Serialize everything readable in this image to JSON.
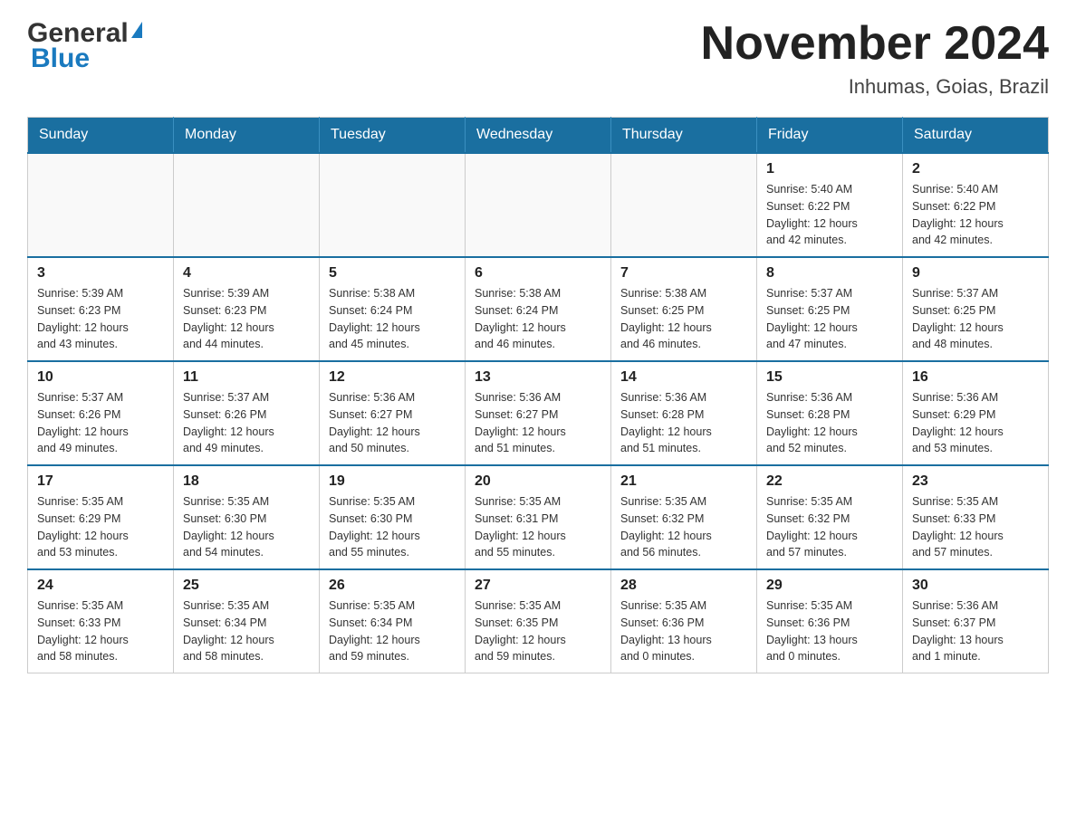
{
  "header": {
    "logo_text_black": "General",
    "logo_text_blue": "Blue",
    "month_title": "November 2024",
    "location": "Inhumas, Goias, Brazil"
  },
  "weekdays": [
    "Sunday",
    "Monday",
    "Tuesday",
    "Wednesday",
    "Thursday",
    "Friday",
    "Saturday"
  ],
  "weeks": [
    [
      {
        "day": "",
        "info": ""
      },
      {
        "day": "",
        "info": ""
      },
      {
        "day": "",
        "info": ""
      },
      {
        "day": "",
        "info": ""
      },
      {
        "day": "",
        "info": ""
      },
      {
        "day": "1",
        "info": "Sunrise: 5:40 AM\nSunset: 6:22 PM\nDaylight: 12 hours\nand 42 minutes."
      },
      {
        "day": "2",
        "info": "Sunrise: 5:40 AM\nSunset: 6:22 PM\nDaylight: 12 hours\nand 42 minutes."
      }
    ],
    [
      {
        "day": "3",
        "info": "Sunrise: 5:39 AM\nSunset: 6:23 PM\nDaylight: 12 hours\nand 43 minutes."
      },
      {
        "day": "4",
        "info": "Sunrise: 5:39 AM\nSunset: 6:23 PM\nDaylight: 12 hours\nand 44 minutes."
      },
      {
        "day": "5",
        "info": "Sunrise: 5:38 AM\nSunset: 6:24 PM\nDaylight: 12 hours\nand 45 minutes."
      },
      {
        "day": "6",
        "info": "Sunrise: 5:38 AM\nSunset: 6:24 PM\nDaylight: 12 hours\nand 46 minutes."
      },
      {
        "day": "7",
        "info": "Sunrise: 5:38 AM\nSunset: 6:25 PM\nDaylight: 12 hours\nand 46 minutes."
      },
      {
        "day": "8",
        "info": "Sunrise: 5:37 AM\nSunset: 6:25 PM\nDaylight: 12 hours\nand 47 minutes."
      },
      {
        "day": "9",
        "info": "Sunrise: 5:37 AM\nSunset: 6:25 PM\nDaylight: 12 hours\nand 48 minutes."
      }
    ],
    [
      {
        "day": "10",
        "info": "Sunrise: 5:37 AM\nSunset: 6:26 PM\nDaylight: 12 hours\nand 49 minutes."
      },
      {
        "day": "11",
        "info": "Sunrise: 5:37 AM\nSunset: 6:26 PM\nDaylight: 12 hours\nand 49 minutes."
      },
      {
        "day": "12",
        "info": "Sunrise: 5:36 AM\nSunset: 6:27 PM\nDaylight: 12 hours\nand 50 minutes."
      },
      {
        "day": "13",
        "info": "Sunrise: 5:36 AM\nSunset: 6:27 PM\nDaylight: 12 hours\nand 51 minutes."
      },
      {
        "day": "14",
        "info": "Sunrise: 5:36 AM\nSunset: 6:28 PM\nDaylight: 12 hours\nand 51 minutes."
      },
      {
        "day": "15",
        "info": "Sunrise: 5:36 AM\nSunset: 6:28 PM\nDaylight: 12 hours\nand 52 minutes."
      },
      {
        "day": "16",
        "info": "Sunrise: 5:36 AM\nSunset: 6:29 PM\nDaylight: 12 hours\nand 53 minutes."
      }
    ],
    [
      {
        "day": "17",
        "info": "Sunrise: 5:35 AM\nSunset: 6:29 PM\nDaylight: 12 hours\nand 53 minutes."
      },
      {
        "day": "18",
        "info": "Sunrise: 5:35 AM\nSunset: 6:30 PM\nDaylight: 12 hours\nand 54 minutes."
      },
      {
        "day": "19",
        "info": "Sunrise: 5:35 AM\nSunset: 6:30 PM\nDaylight: 12 hours\nand 55 minutes."
      },
      {
        "day": "20",
        "info": "Sunrise: 5:35 AM\nSunset: 6:31 PM\nDaylight: 12 hours\nand 55 minutes."
      },
      {
        "day": "21",
        "info": "Sunrise: 5:35 AM\nSunset: 6:32 PM\nDaylight: 12 hours\nand 56 minutes."
      },
      {
        "day": "22",
        "info": "Sunrise: 5:35 AM\nSunset: 6:32 PM\nDaylight: 12 hours\nand 57 minutes."
      },
      {
        "day": "23",
        "info": "Sunrise: 5:35 AM\nSunset: 6:33 PM\nDaylight: 12 hours\nand 57 minutes."
      }
    ],
    [
      {
        "day": "24",
        "info": "Sunrise: 5:35 AM\nSunset: 6:33 PM\nDaylight: 12 hours\nand 58 minutes."
      },
      {
        "day": "25",
        "info": "Sunrise: 5:35 AM\nSunset: 6:34 PM\nDaylight: 12 hours\nand 58 minutes."
      },
      {
        "day": "26",
        "info": "Sunrise: 5:35 AM\nSunset: 6:34 PM\nDaylight: 12 hours\nand 59 minutes."
      },
      {
        "day": "27",
        "info": "Sunrise: 5:35 AM\nSunset: 6:35 PM\nDaylight: 12 hours\nand 59 minutes."
      },
      {
        "day": "28",
        "info": "Sunrise: 5:35 AM\nSunset: 6:36 PM\nDaylight: 13 hours\nand 0 minutes."
      },
      {
        "day": "29",
        "info": "Sunrise: 5:35 AM\nSunset: 6:36 PM\nDaylight: 13 hours\nand 0 minutes."
      },
      {
        "day": "30",
        "info": "Sunrise: 5:36 AM\nSunset: 6:37 PM\nDaylight: 13 hours\nand 1 minute."
      }
    ]
  ]
}
